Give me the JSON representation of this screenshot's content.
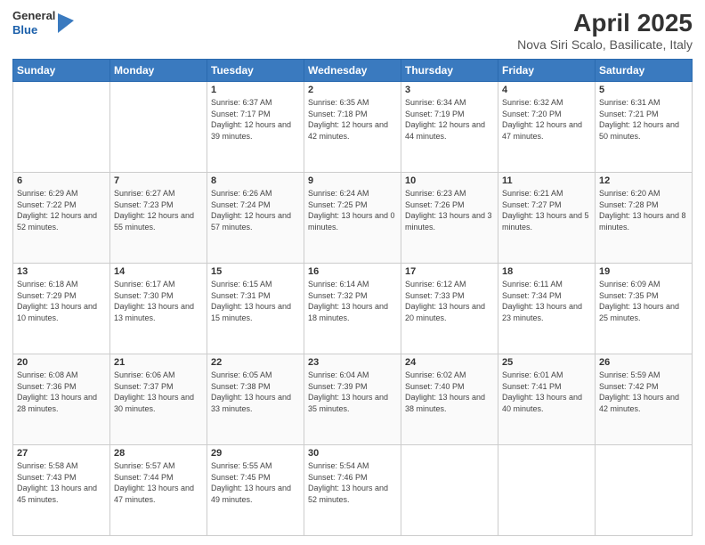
{
  "header": {
    "logo_general": "General",
    "logo_blue": "Blue",
    "month_year": "April 2025",
    "location": "Nova Siri Scalo, Basilicate, Italy"
  },
  "weekdays": [
    "Sunday",
    "Monday",
    "Tuesday",
    "Wednesday",
    "Thursday",
    "Friday",
    "Saturday"
  ],
  "weeks": [
    [
      null,
      null,
      {
        "day": "1",
        "sunrise": "Sunrise: 6:37 AM",
        "sunset": "Sunset: 7:17 PM",
        "daylight": "Daylight: 12 hours and 39 minutes."
      },
      {
        "day": "2",
        "sunrise": "Sunrise: 6:35 AM",
        "sunset": "Sunset: 7:18 PM",
        "daylight": "Daylight: 12 hours and 42 minutes."
      },
      {
        "day": "3",
        "sunrise": "Sunrise: 6:34 AM",
        "sunset": "Sunset: 7:19 PM",
        "daylight": "Daylight: 12 hours and 44 minutes."
      },
      {
        "day": "4",
        "sunrise": "Sunrise: 6:32 AM",
        "sunset": "Sunset: 7:20 PM",
        "daylight": "Daylight: 12 hours and 47 minutes."
      },
      {
        "day": "5",
        "sunrise": "Sunrise: 6:31 AM",
        "sunset": "Sunset: 7:21 PM",
        "daylight": "Daylight: 12 hours and 50 minutes."
      }
    ],
    [
      {
        "day": "6",
        "sunrise": "Sunrise: 6:29 AM",
        "sunset": "Sunset: 7:22 PM",
        "daylight": "Daylight: 12 hours and 52 minutes."
      },
      {
        "day": "7",
        "sunrise": "Sunrise: 6:27 AM",
        "sunset": "Sunset: 7:23 PM",
        "daylight": "Daylight: 12 hours and 55 minutes."
      },
      {
        "day": "8",
        "sunrise": "Sunrise: 6:26 AM",
        "sunset": "Sunset: 7:24 PM",
        "daylight": "Daylight: 12 hours and 57 minutes."
      },
      {
        "day": "9",
        "sunrise": "Sunrise: 6:24 AM",
        "sunset": "Sunset: 7:25 PM",
        "daylight": "Daylight: 13 hours and 0 minutes."
      },
      {
        "day": "10",
        "sunrise": "Sunrise: 6:23 AM",
        "sunset": "Sunset: 7:26 PM",
        "daylight": "Daylight: 13 hours and 3 minutes."
      },
      {
        "day": "11",
        "sunrise": "Sunrise: 6:21 AM",
        "sunset": "Sunset: 7:27 PM",
        "daylight": "Daylight: 13 hours and 5 minutes."
      },
      {
        "day": "12",
        "sunrise": "Sunrise: 6:20 AM",
        "sunset": "Sunset: 7:28 PM",
        "daylight": "Daylight: 13 hours and 8 minutes."
      }
    ],
    [
      {
        "day": "13",
        "sunrise": "Sunrise: 6:18 AM",
        "sunset": "Sunset: 7:29 PM",
        "daylight": "Daylight: 13 hours and 10 minutes."
      },
      {
        "day": "14",
        "sunrise": "Sunrise: 6:17 AM",
        "sunset": "Sunset: 7:30 PM",
        "daylight": "Daylight: 13 hours and 13 minutes."
      },
      {
        "day": "15",
        "sunrise": "Sunrise: 6:15 AM",
        "sunset": "Sunset: 7:31 PM",
        "daylight": "Daylight: 13 hours and 15 minutes."
      },
      {
        "day": "16",
        "sunrise": "Sunrise: 6:14 AM",
        "sunset": "Sunset: 7:32 PM",
        "daylight": "Daylight: 13 hours and 18 minutes."
      },
      {
        "day": "17",
        "sunrise": "Sunrise: 6:12 AM",
        "sunset": "Sunset: 7:33 PM",
        "daylight": "Daylight: 13 hours and 20 minutes."
      },
      {
        "day": "18",
        "sunrise": "Sunrise: 6:11 AM",
        "sunset": "Sunset: 7:34 PM",
        "daylight": "Daylight: 13 hours and 23 minutes."
      },
      {
        "day": "19",
        "sunrise": "Sunrise: 6:09 AM",
        "sunset": "Sunset: 7:35 PM",
        "daylight": "Daylight: 13 hours and 25 minutes."
      }
    ],
    [
      {
        "day": "20",
        "sunrise": "Sunrise: 6:08 AM",
        "sunset": "Sunset: 7:36 PM",
        "daylight": "Daylight: 13 hours and 28 minutes."
      },
      {
        "day": "21",
        "sunrise": "Sunrise: 6:06 AM",
        "sunset": "Sunset: 7:37 PM",
        "daylight": "Daylight: 13 hours and 30 minutes."
      },
      {
        "day": "22",
        "sunrise": "Sunrise: 6:05 AM",
        "sunset": "Sunset: 7:38 PM",
        "daylight": "Daylight: 13 hours and 33 minutes."
      },
      {
        "day": "23",
        "sunrise": "Sunrise: 6:04 AM",
        "sunset": "Sunset: 7:39 PM",
        "daylight": "Daylight: 13 hours and 35 minutes."
      },
      {
        "day": "24",
        "sunrise": "Sunrise: 6:02 AM",
        "sunset": "Sunset: 7:40 PM",
        "daylight": "Daylight: 13 hours and 38 minutes."
      },
      {
        "day": "25",
        "sunrise": "Sunrise: 6:01 AM",
        "sunset": "Sunset: 7:41 PM",
        "daylight": "Daylight: 13 hours and 40 minutes."
      },
      {
        "day": "26",
        "sunrise": "Sunrise: 5:59 AM",
        "sunset": "Sunset: 7:42 PM",
        "daylight": "Daylight: 13 hours and 42 minutes."
      }
    ],
    [
      {
        "day": "27",
        "sunrise": "Sunrise: 5:58 AM",
        "sunset": "Sunset: 7:43 PM",
        "daylight": "Daylight: 13 hours and 45 minutes."
      },
      {
        "day": "28",
        "sunrise": "Sunrise: 5:57 AM",
        "sunset": "Sunset: 7:44 PM",
        "daylight": "Daylight: 13 hours and 47 minutes."
      },
      {
        "day": "29",
        "sunrise": "Sunrise: 5:55 AM",
        "sunset": "Sunset: 7:45 PM",
        "daylight": "Daylight: 13 hours and 49 minutes."
      },
      {
        "day": "30",
        "sunrise": "Sunrise: 5:54 AM",
        "sunset": "Sunset: 7:46 PM",
        "daylight": "Daylight: 13 hours and 52 minutes."
      },
      null,
      null,
      null
    ]
  ]
}
